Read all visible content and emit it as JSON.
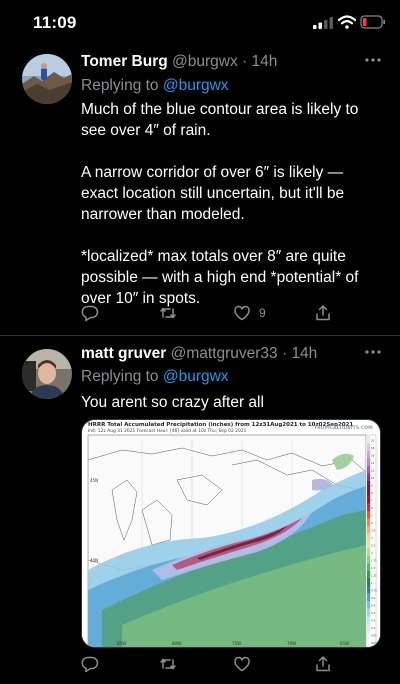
{
  "status_bar": {
    "time": "11:09"
  },
  "tweets": [
    {
      "name": "Tomer Burg",
      "handle": "@burgwx",
      "time": "14h",
      "replying_prefix": "Replying to",
      "replying_to": "@burgwx",
      "paragraphs": [
        "Much of the blue contour area is likely to see over 4″ of rain.",
        "A narrow corridor of over 6″ is likely — exact location still uncertain, but it'll be narrower than modeled.",
        "*localized* max totals over 8″ are quite possible — with a high end *potential* of over 10″ in spots."
      ],
      "actions": {
        "reply_count": "",
        "retweet_count": "",
        "like_count": "9"
      }
    },
    {
      "name": "matt gruver",
      "handle": "@mattgruver33",
      "time": "14h",
      "replying_prefix": "Replying to",
      "replying_to": "@burgwx",
      "text": "You arent so crazy after all",
      "media": {
        "title": "HRRR Total Accumulated Precipitation (inches) from 12z31Aug2021 to 10z02Sep2021",
        "subtitle": "Init: 12z Aug 31 2021   Forecast Hour: [46]   valid at 10z Thu, Sep 02 2021",
        "brand": "TROPICALTIDBITS.COM",
        "legend_ticks": [
          "20",
          "18",
          "16",
          "14",
          "12",
          "10",
          "9",
          "8",
          "7",
          "6",
          "5",
          "4",
          "3.5",
          "3",
          "2.5",
          "2",
          "1.75",
          "1.5",
          "1.25",
          "1",
          "0.75",
          "0.5",
          "0.4",
          "0.3",
          "0.2",
          "0.1",
          "0.05",
          "0.01"
        ],
        "longitude_labels": [
          "85W",
          "80W",
          "75W",
          "70W",
          "65W"
        ],
        "latitude_labels": [
          "45N",
          "40N"
        ]
      },
      "actions": {
        "reply_count": "",
        "retweet_count": "",
        "like_count": ""
      }
    }
  ],
  "colors": {
    "accent": "#1d9bf0",
    "secondary_text": "#8b8f94",
    "background": "#000000"
  },
  "icons": [
    "signal-icon",
    "wifi-icon",
    "battery-icon",
    "more-icon",
    "reply-icon",
    "retweet-icon",
    "like-icon",
    "share-icon"
  ]
}
